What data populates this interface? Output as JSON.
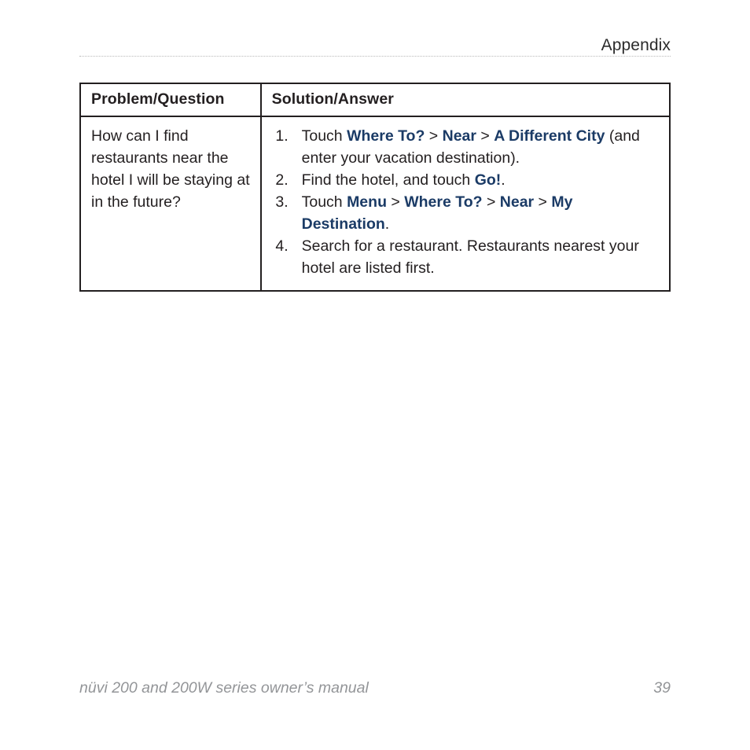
{
  "header": {
    "title": "Appendix"
  },
  "table": {
    "columns": [
      {
        "label": "Problem/Question"
      },
      {
        "label": "Solution/Answer"
      }
    ],
    "rows": [
      {
        "question": "How can I find restaurants near the hotel I will be staying at in the future?",
        "steps": [
          {
            "number": "1.",
            "parts": [
              {
                "text": "Touch ",
                "style": "plain"
              },
              {
                "text": "Where To?",
                "style": "ui"
              },
              {
                "text": " > ",
                "style": "sep"
              },
              {
                "text": "Near",
                "style": "ui"
              },
              {
                "text": " > ",
                "style": "sep"
              },
              {
                "text": "A Different City",
                "style": "ui"
              },
              {
                "text": " (and enter your vacation destination).",
                "style": "plain"
              }
            ]
          },
          {
            "number": "2.",
            "parts": [
              {
                "text": "Find the hotel, and touch ",
                "style": "plain"
              },
              {
                "text": "Go!",
                "style": "ui"
              },
              {
                "text": ".",
                "style": "plain"
              }
            ]
          },
          {
            "number": "3.",
            "parts": [
              {
                "text": "Touch ",
                "style": "plain"
              },
              {
                "text": "Menu",
                "style": "ui"
              },
              {
                "text": " > ",
                "style": "sep"
              },
              {
                "text": "Where To?",
                "style": "ui"
              },
              {
                "text": " > ",
                "style": "sep"
              },
              {
                "text": "Near",
                "style": "ui"
              },
              {
                "text": " > ",
                "style": "sep"
              },
              {
                "text": "My Destination",
                "style": "ui"
              },
              {
                "text": ".",
                "style": "plain"
              }
            ]
          },
          {
            "number": "4.",
            "parts": [
              {
                "text": "Search for a restaurant. Restaurants nearest your hotel are listed first.",
                "style": "plain"
              }
            ]
          }
        ]
      }
    ]
  },
  "footer": {
    "manual_title": "nüvi 200 and 200W series owner’s manual",
    "page_number": "39"
  },
  "colors": {
    "ui_term": "#1b3b66",
    "body_text": "#231f20",
    "footer_text": "#939598",
    "rule": "#b9b9b9"
  }
}
